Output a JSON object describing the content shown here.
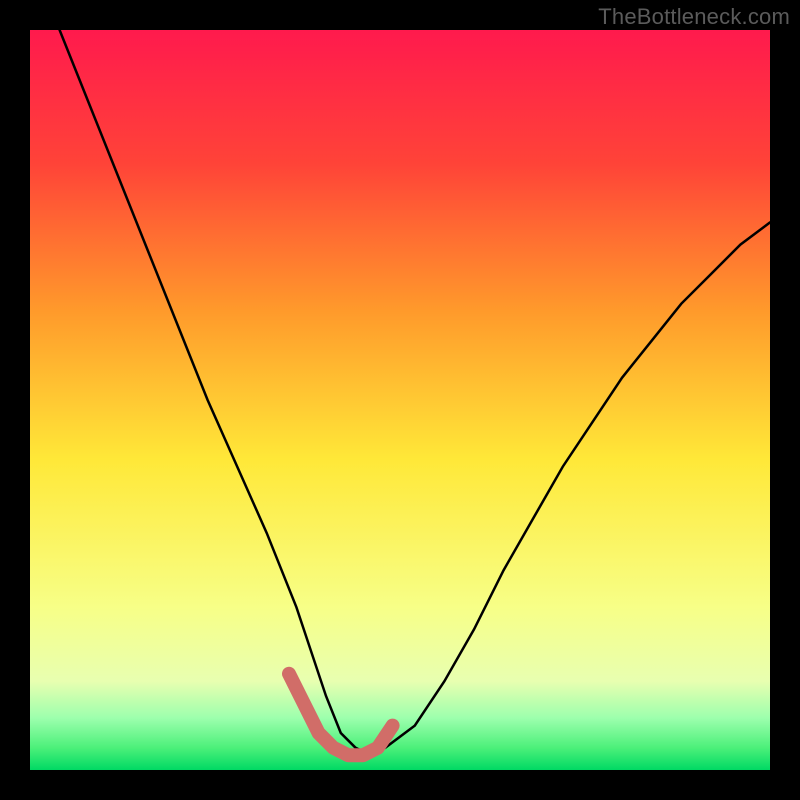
{
  "watermark": "TheBottleneck.com",
  "chart_data": {
    "type": "line",
    "title": "",
    "xlabel": "",
    "ylabel": "",
    "xlim": [
      0,
      100
    ],
    "ylim": [
      0,
      100
    ],
    "grid": false,
    "legend": false,
    "background_gradient": {
      "top": "#ff1a4d",
      "mid1": "#ff7a2b",
      "mid2": "#ffe838",
      "mid3": "#f5ff7a",
      "green_band": "#66ff79",
      "bottom": "#00d964"
    },
    "series": [
      {
        "name": "bottleneck-curve",
        "stroke": "#000000",
        "x": [
          4,
          8,
          12,
          16,
          20,
          24,
          28,
          32,
          36,
          38,
          40,
          42,
          44,
          46,
          48,
          52,
          56,
          60,
          64,
          68,
          72,
          76,
          80,
          84,
          88,
          92,
          96,
          100
        ],
        "y": [
          100,
          90,
          80,
          70,
          60,
          50,
          41,
          32,
          22,
          16,
          10,
          5,
          3,
          2,
          3,
          6,
          12,
          19,
          27,
          34,
          41,
          47,
          53,
          58,
          63,
          67,
          71,
          74
        ]
      }
    ],
    "highlight": {
      "name": "optimal-zone",
      "stroke": "#d16d68",
      "x": [
        35,
        37,
        39,
        41,
        43,
        45,
        47,
        49
      ],
      "y": [
        13,
        9,
        5,
        3,
        2,
        2,
        3,
        6
      ]
    }
  }
}
